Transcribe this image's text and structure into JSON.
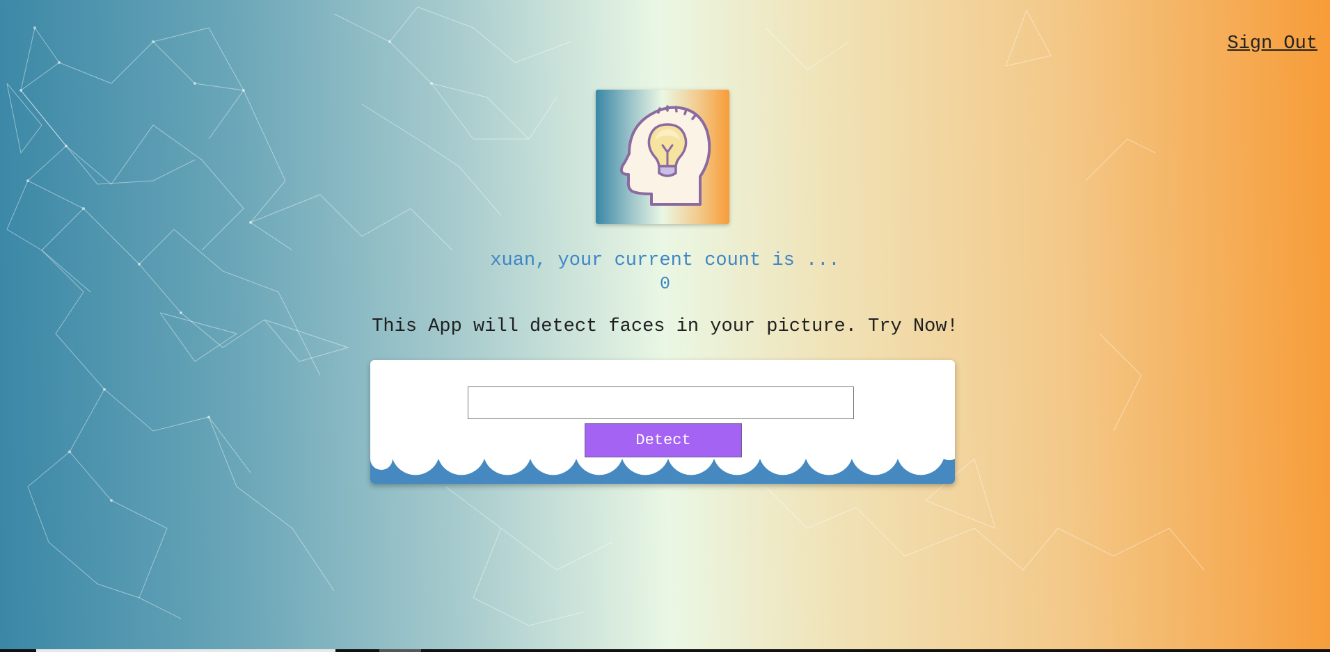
{
  "header": {
    "signout_label": "Sign Out"
  },
  "logo": {
    "icon": "head-lightbulb-icon"
  },
  "rank": {
    "message": "xuan, your current count is ...",
    "count": "0"
  },
  "intro": {
    "text": "This App will detect faces in your picture. Try Now!"
  },
  "form": {
    "input_value": "",
    "button_label": "Detect"
  },
  "colors": {
    "gradient_start": "#3a87a6",
    "gradient_mid": "#eaf7e4",
    "gradient_end": "#f79c38",
    "count_text": "#3f86c6",
    "button": "#a463f2",
    "wave": "#4589c0"
  }
}
